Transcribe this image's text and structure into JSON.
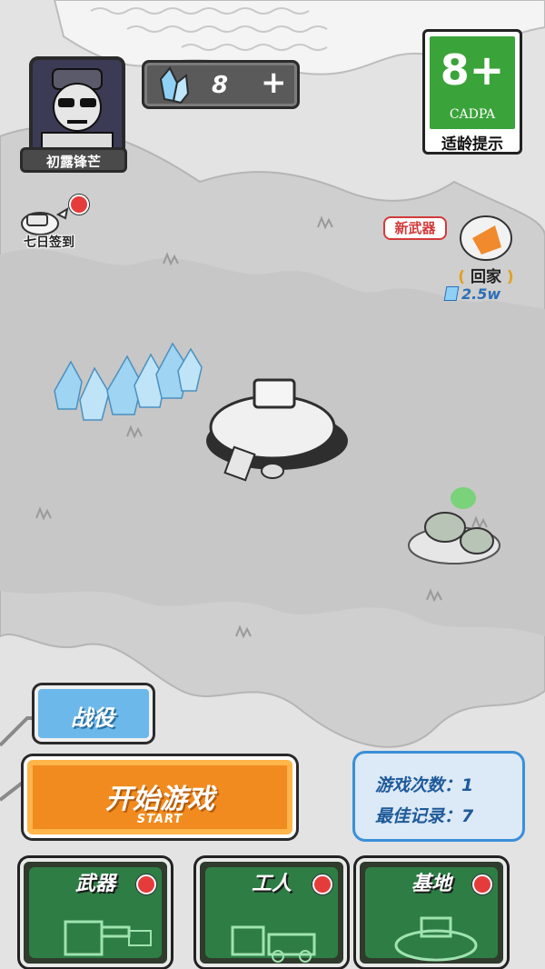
{
  "player": {
    "name": "初露锋芒"
  },
  "currency": {
    "gems": "8",
    "plus": "+"
  },
  "age_rating": {
    "number": "8+",
    "org": "CADPA",
    "label": "适龄提示"
  },
  "signin": {
    "label": "七日签到"
  },
  "new_weapon": {
    "tag": "新武器",
    "home": "回家",
    "power": "2.5w"
  },
  "buttons": {
    "campaign": "战役",
    "start": "开始游戏",
    "start_sub": "START"
  },
  "stats": {
    "plays": "游戏次数：1",
    "best": "最佳记录：7"
  },
  "cards": [
    {
      "title": "武器"
    },
    {
      "title": "工人"
    },
    {
      "title": "基地"
    }
  ],
  "colors": {
    "accent_orange": "#f28b1f",
    "accent_blue": "#6db8ea",
    "card_green": "#2e7d45",
    "badge_red": "#e53b3b",
    "rating_green": "#3aa33a"
  }
}
